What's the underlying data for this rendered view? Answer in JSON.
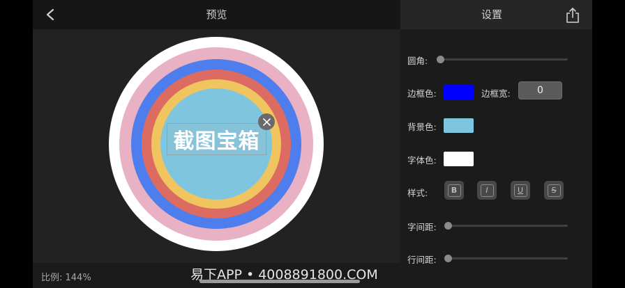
{
  "preview": {
    "title": "预览",
    "scale_label": "比例: 144%",
    "overlay_text": "截图宝箱",
    "rings": [
      {
        "color": "#ffffff",
        "diameter": 308
      },
      {
        "color": "#e9b2c4",
        "diameter": 278
      },
      {
        "color": "#4e7ded",
        "diameter": 244
      },
      {
        "color": "#dc6b61",
        "diameter": 214
      },
      {
        "color": "#f0c45f",
        "diameter": 186
      },
      {
        "color": "#7ec6df",
        "diameter": 160
      }
    ]
  },
  "watermark": "易下APP • 4008891800.COM",
  "settings": {
    "title": "设置",
    "corner_radius": {
      "label": "圆角:",
      "value": 0
    },
    "border_color": {
      "label": "边框色:",
      "color": "#0000ff"
    },
    "border_width": {
      "label": "边框宽:",
      "value": "0"
    },
    "background_color": {
      "label": "背景色:",
      "color": "#7ec6df"
    },
    "font_color": {
      "label": "字体色:",
      "color": "#ffffff"
    },
    "style": {
      "label": "样式:",
      "buttons": [
        "B",
        "I",
        "U",
        "S"
      ]
    },
    "letter_spacing": {
      "label": "字间距:",
      "value": 0
    },
    "line_spacing": {
      "label": "行间距:",
      "value": 0
    }
  },
  "icons": {
    "back": "chevron-left-icon",
    "share": "share-icon",
    "close": "close-icon"
  },
  "colors": {
    "header_bg": "#161616",
    "panel_bg": "#1b1b1b",
    "canvas_bg": "#222222"
  }
}
